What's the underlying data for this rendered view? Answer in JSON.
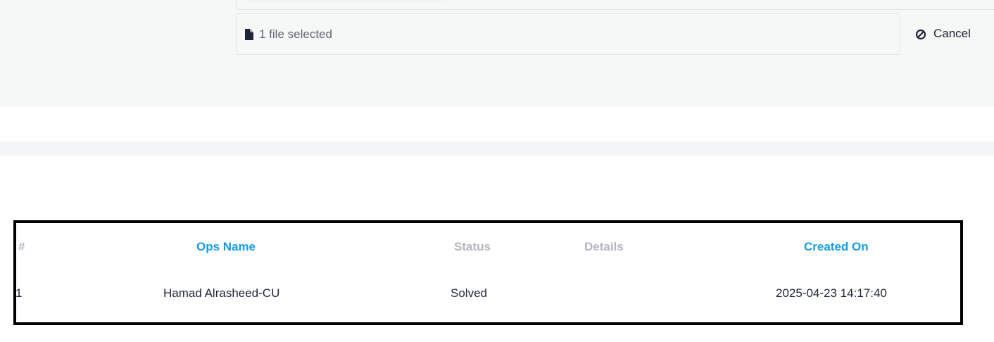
{
  "upload": {
    "file_status": "1 file selected",
    "cancel_label": "Cancel"
  },
  "table": {
    "headers": {
      "index": "#",
      "ops_name": "Ops Name",
      "status": "Status",
      "details": "Details",
      "created_on": "Created On"
    },
    "rows": [
      {
        "index": "1",
        "ops_name": "Hamad Alrasheed-CU",
        "status": "Solved",
        "details": "",
        "created_on": "2025-04-23 14:17:40"
      }
    ]
  },
  "icons": {
    "file": "file-icon",
    "cancel": "ban-icon"
  },
  "colors": {
    "header_sortable": "#159ce6",
    "header_plain": "#b3b6c1",
    "panel_bg": "#f6f7f7",
    "text": "#1f2537"
  }
}
